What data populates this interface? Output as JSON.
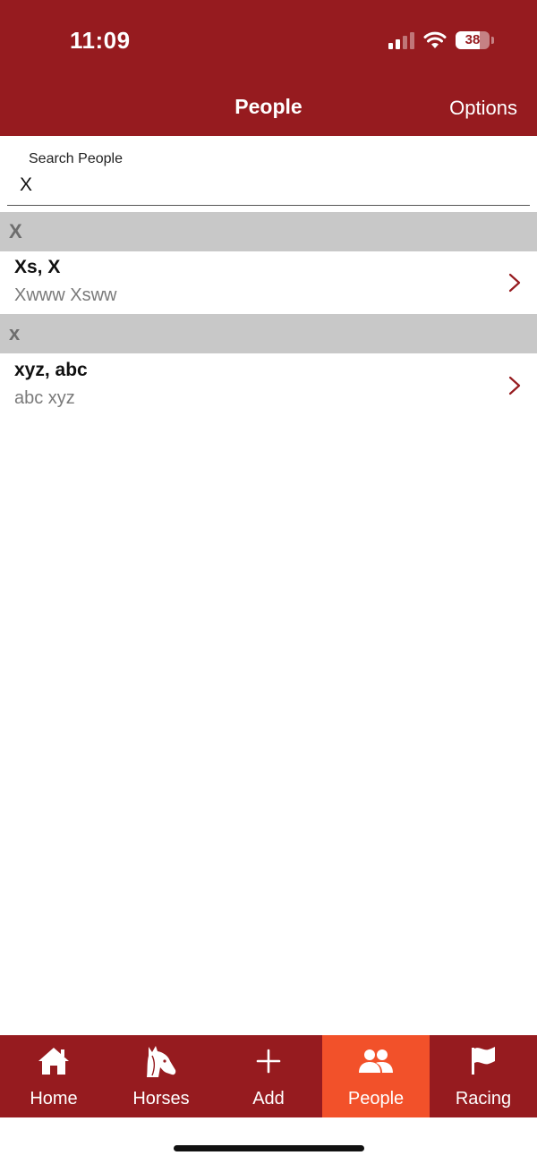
{
  "status_bar": {
    "time": "11:09",
    "battery": "38"
  },
  "nav": {
    "title": "People",
    "options_label": "Options"
  },
  "search": {
    "label": "Search People",
    "value": "X"
  },
  "sections": [
    {
      "header": "X",
      "items": [
        {
          "title": "Xs, X",
          "subtitle": "Xwww Xsww"
        }
      ]
    },
    {
      "header": "x",
      "items": [
        {
          "title": "xyz, abc",
          "subtitle": "abc xyz"
        }
      ]
    }
  ],
  "tabs": [
    {
      "label": "Home",
      "icon": "home-icon"
    },
    {
      "label": "Horses",
      "icon": "horse-icon"
    },
    {
      "label": "Add",
      "icon": "plus-icon"
    },
    {
      "label": "People",
      "icon": "people-icon",
      "active": true
    },
    {
      "label": "Racing",
      "icon": "flag-icon"
    }
  ],
  "colors": {
    "brand": "#961b1f",
    "active_tab": "#f2512a",
    "section_bg": "#c8c8c8",
    "chevron": "#961b1f"
  }
}
